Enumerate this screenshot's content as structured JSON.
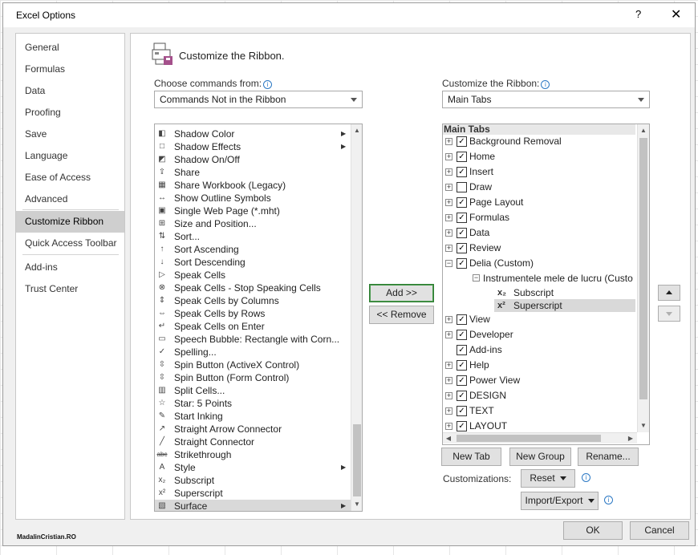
{
  "window": {
    "title": "Excel Options",
    "help": "?",
    "close": "✕"
  },
  "nav": {
    "items": [
      "General",
      "Formulas",
      "Data",
      "Proofing",
      "Save",
      "Language",
      "Ease of Access",
      "Advanced",
      "Customize Ribbon",
      "Quick Access Toolbar",
      "Add-ins",
      "Trust Center"
    ],
    "active": "Customize Ribbon"
  },
  "header": {
    "title": "Customize the Ribbon."
  },
  "left": {
    "label": "Choose commands from:",
    "combo_value": "Commands Not in the Ribbon",
    "commands": [
      {
        "label": "Shadow Color",
        "icon": "shadow-color-icon",
        "submenu": true
      },
      {
        "label": "Shadow Effects",
        "icon": "shadow-effects-icon",
        "submenu": true
      },
      {
        "label": "Shadow On/Off",
        "icon": "shadow-onoff-icon"
      },
      {
        "label": "Share",
        "icon": "share-icon"
      },
      {
        "label": "Share Workbook (Legacy)",
        "icon": "share-workbook-icon"
      },
      {
        "label": "Show Outline Symbols",
        "icon": "outline-symbols-icon"
      },
      {
        "label": "Single Web Page (*.mht)",
        "icon": "web-page-icon"
      },
      {
        "label": "Size and Position...",
        "icon": "size-position-icon"
      },
      {
        "label": "Sort...",
        "icon": "sort-icon"
      },
      {
        "label": "Sort Ascending",
        "icon": "sort-ascending-icon"
      },
      {
        "label": "Sort Descending",
        "icon": "sort-descending-icon"
      },
      {
        "label": "Speak Cells",
        "icon": "speak-cells-icon"
      },
      {
        "label": "Speak Cells - Stop Speaking Cells",
        "icon": "stop-speaking-icon"
      },
      {
        "label": "Speak Cells by Columns",
        "icon": "speak-columns-icon"
      },
      {
        "label": "Speak Cells by Rows",
        "icon": "speak-rows-icon"
      },
      {
        "label": "Speak Cells on Enter",
        "icon": "speak-enter-icon"
      },
      {
        "label": "Speech Bubble: Rectangle with Corn...",
        "icon": "speech-bubble-icon"
      },
      {
        "label": "Spelling...",
        "icon": "spelling-icon"
      },
      {
        "label": "Spin Button (ActiveX Control)",
        "icon": "spin-activex-icon"
      },
      {
        "label": "Spin Button (Form Control)",
        "icon": "spin-form-icon"
      },
      {
        "label": "Split Cells...",
        "icon": "split-cells-icon"
      },
      {
        "label": "Star: 5 Points",
        "icon": "star-icon"
      },
      {
        "label": "Start Inking",
        "icon": "inking-icon"
      },
      {
        "label": "Straight Arrow Connector",
        "icon": "arrow-connector-icon"
      },
      {
        "label": "Straight Connector",
        "icon": "straight-connector-icon"
      },
      {
        "label": "Strikethrough",
        "icon": "strikethrough-icon"
      },
      {
        "label": "Style",
        "icon": "style-icon",
        "submenu": true
      },
      {
        "label": "Subscript",
        "icon": "subscript-icon"
      },
      {
        "label": "Superscript",
        "icon": "superscript-icon"
      },
      {
        "label": "Surface",
        "icon": "surface-icon",
        "submenu": true,
        "selected": true
      }
    ]
  },
  "buttons": {
    "add": "Add >>",
    "remove": "<< Remove"
  },
  "right": {
    "label": "Customize the Ribbon:",
    "combo_value": "Main Tabs",
    "tree_header": "Main Tabs",
    "tabs_before": [
      {
        "label": "Background Removal",
        "checked": true
      },
      {
        "label": "Home",
        "checked": true
      },
      {
        "label": "Insert",
        "checked": true
      },
      {
        "label": "Draw",
        "checked": false
      },
      {
        "label": "Page Layout",
        "checked": true
      },
      {
        "label": "Formulas",
        "checked": true
      },
      {
        "label": "Data",
        "checked": true
      },
      {
        "label": "Review",
        "checked": true
      },
      {
        "label": "Delia (Custom)",
        "checked": true,
        "expanded": true
      }
    ],
    "group_label": "Instrumentele mele de lucru  (Custo",
    "group_items": [
      {
        "label": "Subscript",
        "icon": "subscript-icon"
      },
      {
        "label": "Superscript",
        "icon": "superscript-icon",
        "selected": true
      }
    ],
    "tabs_after": [
      {
        "label": "View",
        "checked": true,
        "expander": true
      },
      {
        "label": "Developer",
        "checked": true,
        "expander": true
      },
      {
        "label": "Add-ins",
        "checked": true,
        "expander": false
      },
      {
        "label": "Help",
        "checked": true,
        "expander": true
      },
      {
        "label": "Power View",
        "checked": true,
        "expander": true
      },
      {
        "label": "DESIGN",
        "checked": true,
        "expander": true
      },
      {
        "label": "TEXT",
        "checked": true,
        "expander": true
      },
      {
        "label": "LAYOUT",
        "checked": true,
        "expander": true
      }
    ],
    "new_tab": "New Tab",
    "new_group": "New Group",
    "rename": "Rename...",
    "customizations_label": "Customizations:",
    "reset": "Reset",
    "import_export": "Import/Export"
  },
  "footer": {
    "ok": "OK",
    "cancel": "Cancel"
  },
  "watermark": "MadalinCristian.RO"
}
